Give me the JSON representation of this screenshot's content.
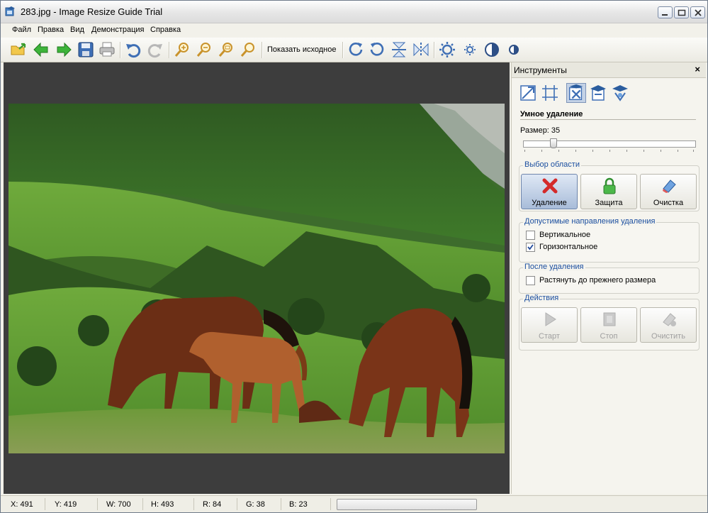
{
  "window": {
    "title": "283.jpg - Image Resize Guide Trial",
    "accent_color": "#3a7bd5"
  },
  "menu": {
    "items": [
      "Файл",
      "Правка",
      "Вид",
      "Демонстрация",
      "Справка"
    ]
  },
  "toolbar": {
    "show_original_label": "Показать исходное",
    "icons": [
      "open-folder-icon",
      "back-arrow-icon",
      "forward-arrow-icon",
      "save-icon",
      "print-icon",
      "undo-icon",
      "redo-icon",
      "zoom-in-icon",
      "zoom-out-icon",
      "zoom-fit-icon",
      "zoom-actual-icon",
      "rotate-cw-icon",
      "rotate-ccw-icon",
      "flip-vertical-icon",
      "flip-horizontal-icon",
      "brightness-up-icon",
      "brightness-down-icon",
      "contrast-up-icon",
      "contrast-down-icon"
    ]
  },
  "panel": {
    "title": "Инструменты",
    "close_label": "×",
    "section_title": "Умное удаление",
    "size_label": "Размер: 35",
    "size_value": 35,
    "area_group": {
      "label": "Выбор области",
      "buttons": [
        "Удаление",
        "Защита",
        "Очистка"
      ]
    },
    "directions_group": {
      "label": "Допустимые направления удаления",
      "options": [
        {
          "label": "Вертикальное",
          "checked": false
        },
        {
          "label": "Горизонтальное",
          "checked": true
        }
      ]
    },
    "after_group": {
      "label": "После удаления",
      "options": [
        {
          "label": "Растянуть до прежнего размера",
          "checked": false
        }
      ]
    },
    "actions_group": {
      "label": "Действия",
      "buttons": [
        "Старт",
        "Стоп",
        "Очистить"
      ]
    }
  },
  "status": {
    "x": "X: 491",
    "y": "Y: 419",
    "w": "W: 700",
    "h": "H: 493",
    "r": "R: 84",
    "g": "G: 38",
    "b": "B: 23"
  }
}
